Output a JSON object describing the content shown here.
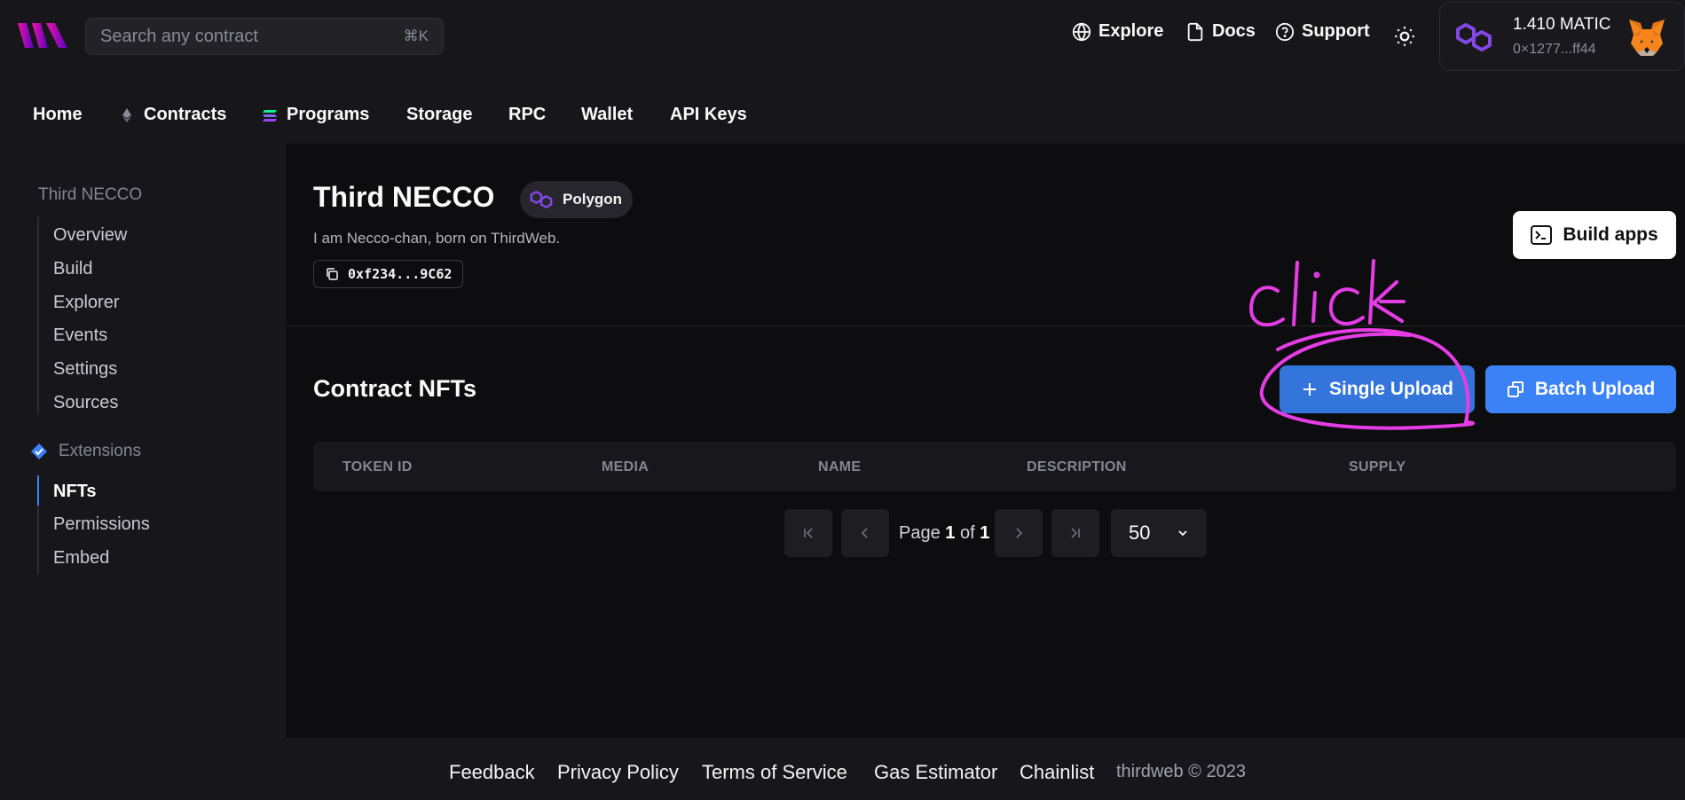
{
  "header": {
    "search_placeholder": "Search any contract",
    "search_shortcut": "⌘K",
    "nav": [
      {
        "label": "Explore",
        "icon": "globe-icon"
      },
      {
        "label": "Docs",
        "icon": "file-icon"
      },
      {
        "label": "Support",
        "icon": "help-circle-icon"
      }
    ],
    "wallet": {
      "balance": "1.410 MATIC",
      "address": "0×1277...ff44"
    }
  },
  "tabs": [
    {
      "label": "Home"
    },
    {
      "label": "Contracts",
      "icon": "ethereum-icon"
    },
    {
      "label": "Programs",
      "icon": "solana-icon"
    },
    {
      "label": "Storage"
    },
    {
      "label": "RPC"
    },
    {
      "label": "Wallet"
    },
    {
      "label": "API Keys"
    }
  ],
  "sidebar": {
    "contract_name": "Third NECCO",
    "items": [
      {
        "label": "Overview"
      },
      {
        "label": "Build"
      },
      {
        "label": "Explorer"
      },
      {
        "label": "Events"
      },
      {
        "label": "Settings"
      },
      {
        "label": "Sources"
      }
    ],
    "extensions_label": "Extensions",
    "extension_items": [
      {
        "label": "NFTs",
        "active": true
      },
      {
        "label": "Permissions"
      },
      {
        "label": "Embed"
      }
    ]
  },
  "contract": {
    "title": "Third NECCO",
    "chain": "Polygon",
    "description": "I am Necco-chan, born on ThirdWeb.",
    "address": "0xf234...9C62",
    "build_apps_label": "Build apps"
  },
  "nfts": {
    "title": "Contract NFTs",
    "single_upload_label": "Single Upload",
    "batch_upload_label": "Batch Upload",
    "columns": [
      "TOKEN ID",
      "MEDIA",
      "NAME",
      "DESCRIPTION",
      "SUPPLY"
    ],
    "pagination": {
      "page_prefix": "Page",
      "current": "1",
      "of": "of",
      "total": "1",
      "page_size": "50"
    }
  },
  "annotation": {
    "text": "click",
    "color": "#e63ce6"
  },
  "footer": {
    "links": [
      "Feedback",
      "Privacy Policy",
      "Terms of Service",
      "Gas Estimator",
      "Chainlist"
    ],
    "copyright": "thirdweb © 2023"
  },
  "colors": {
    "accent": "#3b82f6",
    "background": "#0d0d10",
    "polygon": "#8247e5"
  }
}
